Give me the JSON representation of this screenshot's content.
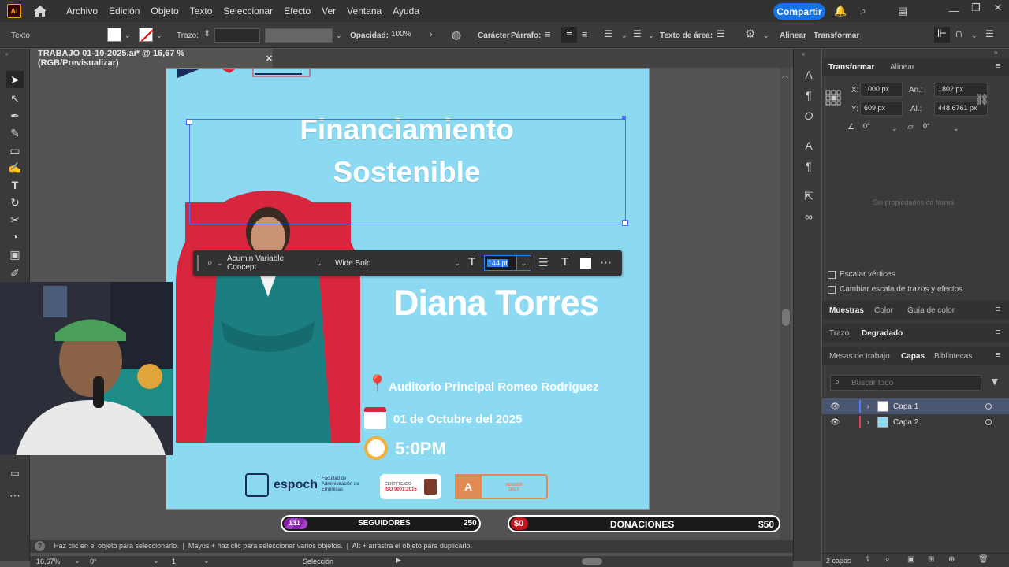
{
  "menubar": {
    "logo": "Ai",
    "items": [
      "Archivo",
      "Edición",
      "Objeto",
      "Texto",
      "Seleccionar",
      "Efecto",
      "Ver",
      "Ventana",
      "Ayuda"
    ],
    "share_label": "Compartir"
  },
  "controlbar": {
    "mode_label": "Texto",
    "stroke_label": "Trazo:",
    "opacity_label": "Opacidad:",
    "opacity_value": "100%",
    "character_label": "Carácter",
    "paragraph_label": "Párrafo:",
    "area_text_label": "Texto de área:",
    "align_label": "Alinear",
    "transform_label": "Transformar"
  },
  "document": {
    "tab_title": "TRABAJO 01-10-2025.ai* @ 16,67 % (RGB/Previsualizar)"
  },
  "artboard": {
    "title_line1": "Financiamiento",
    "title_line2": "Sostenible",
    "speaker": "Diana Torres",
    "venue": "Auditorio Principal Romeo Rodriguez",
    "date": "01 de Octubre del 2025",
    "time": "5:0PM",
    "logo_espoch": "espoch",
    "logo_faculty": "Facultad de Administración de Empresas",
    "cert_label": "CERTIFICADO",
    "cert_iso": "ISO 9001:2015",
    "member_label": "MEMBER ONLY",
    "member_letter": "A"
  },
  "context_bar": {
    "font_family": "Acumin Variable Concept",
    "font_style": "Wide Bold",
    "font_size": "144 pt"
  },
  "transform_panel": {
    "tabs": [
      "Transformar",
      "Alinear"
    ],
    "x_label": "X:",
    "x_value": "1000 px",
    "y_label": "Y:",
    "y_value": "609 px",
    "w_label": "An.:",
    "w_value": "1802 px",
    "h_label": "Al.:",
    "h_value": "448,6761 px",
    "rotate_value": "0°",
    "shear_value": "0°",
    "no_shape_props": "Sin propiedades de forma",
    "scale_corners": "Escalar vértices",
    "scale_strokes": "Cambiar escala de trazos y efectos"
  },
  "swatches_panel": {
    "tabs": [
      "Muestras",
      "Color",
      "Guía de color"
    ]
  },
  "stroke_panel": {
    "tabs": [
      "Trazo",
      "Degradado"
    ]
  },
  "layers_panel": {
    "tabs": [
      "Mesas de trabajo",
      "Capas",
      "Bibliotecas"
    ],
    "search_placeholder": "Buscar todo",
    "layers": [
      {
        "name": "Capa 1",
        "color": "#4f7cff"
      },
      {
        "name": "Capa 2",
        "color": "#e0414d"
      }
    ],
    "count_label": "2 capas"
  },
  "status": {
    "hint": "Haz clic en el objeto para seleccionarlo.  |  Mayús + haz clic para seleccionar varios objetos.  |  Alt + arrastra el objeto para duplicarlo.",
    "zoom": "16,67%",
    "rotation": "0°",
    "artboard_num": "1",
    "tool_name": "Selección"
  },
  "stream": {
    "followers_current": "131",
    "followers_label": "SEGUIDORES",
    "followers_goal": "250",
    "followers_progress": 0.12,
    "donations_current": "$0",
    "donations_label": "DONACIONES",
    "donations_goal": "$50"
  },
  "colors": {
    "accent": "#1473e6",
    "artboard_bg": "#8cd9f2",
    "brand_red": "#d7263d",
    "teal": "#1b7f82"
  }
}
